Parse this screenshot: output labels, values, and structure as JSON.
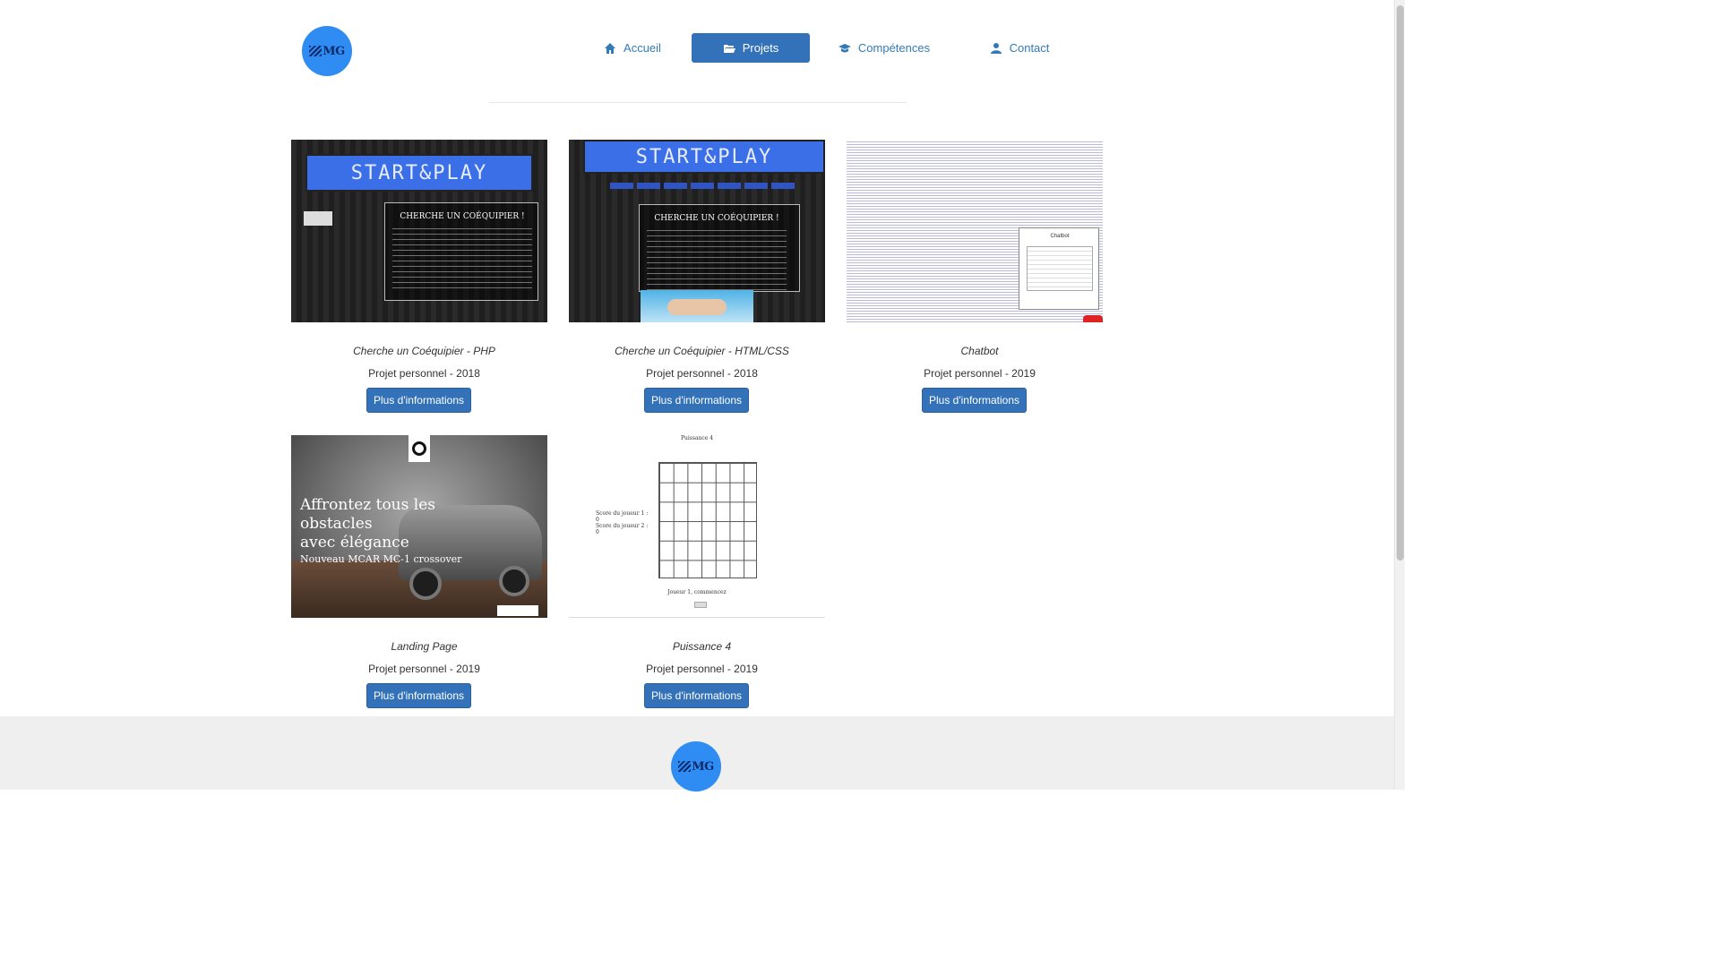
{
  "header": {
    "logo_text": "MG",
    "nav": [
      {
        "label": "Accueil",
        "icon": "home-icon",
        "active": false
      },
      {
        "label": "Projets",
        "icon": "folder-open-icon",
        "active": true
      },
      {
        "label": "Compétences",
        "icon": "graduation-cap-icon",
        "active": false
      },
      {
        "label": "Contact",
        "icon": "user-icon",
        "active": false
      }
    ]
  },
  "projects": [
    {
      "title": "Cherche un Coéquipier - PHP",
      "subtitle": "Projet personnel - 2018",
      "button": "Plus d'informations",
      "thumb": {
        "banner": "START&PLAY",
        "heading": "CHERCHE UN COÉQUIPIER !"
      }
    },
    {
      "title": "Cherche un Coéquipier - HTML/CSS",
      "subtitle": "Projet personnel - 2018",
      "button": "Plus d'informations",
      "thumb": {
        "banner": "START&PLAY",
        "heading": "CHERCHE UN COÉQUIPIER !"
      }
    },
    {
      "title": "Chatbot",
      "subtitle": "Projet personnel - 2019",
      "button": "Plus d'informations",
      "thumb": {
        "popup_title": "Chatbot"
      }
    },
    {
      "title": "Landing Page",
      "subtitle": "Projet personnel - 2019",
      "button": "Plus d'informations",
      "thumb": {
        "line1": "Affrontez tous les obstacles",
        "line2": "avec élégance",
        "line3": "Nouveau MCAR MC-1 crossover"
      }
    },
    {
      "title": "Puissance 4",
      "subtitle": "Projet personnel - 2019",
      "button": "Plus d'informations",
      "thumb": {
        "title": "Puissance 4",
        "score1": "Score du joueur 1 : 0",
        "score2": "Score du joueur 2 : 0",
        "turn": "Joueur 1, commencez"
      }
    }
  ],
  "footer": {
    "logo_text": "MG"
  },
  "colors": {
    "primary": "#3372b9",
    "logo_bg": "#2f8cf2",
    "footer_bg": "#efefef"
  }
}
